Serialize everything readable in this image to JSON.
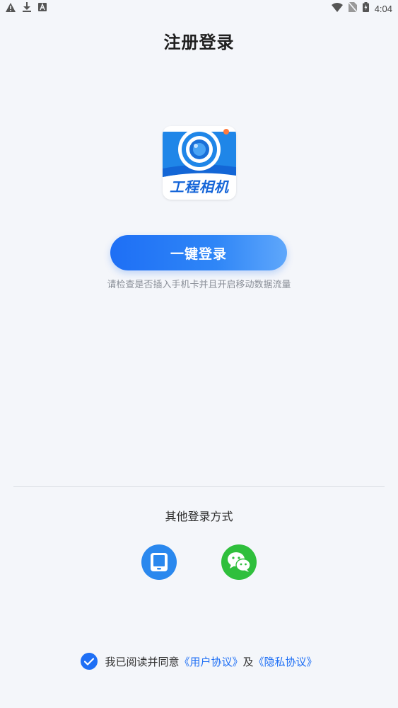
{
  "status_bar": {
    "time": "4:04"
  },
  "page_title": "注册登录",
  "logo": {
    "text": "工程相机"
  },
  "one_click_login": {
    "label": "一键登录"
  },
  "hint": "请检查是否插入手机卡并且开启移动数据流量",
  "other_login": {
    "title": "其他登录方式"
  },
  "agreement": {
    "prefix": "我已阅读并同意",
    "user_agreement": "《用户协议》",
    "conjunction": "及",
    "privacy_policy": "《隐私协议》"
  },
  "colors": {
    "accent": "#1e6ff5",
    "phone_button": "#2a88ee",
    "wechat_button": "#2fbf3c",
    "background": "#f4f6fa"
  }
}
